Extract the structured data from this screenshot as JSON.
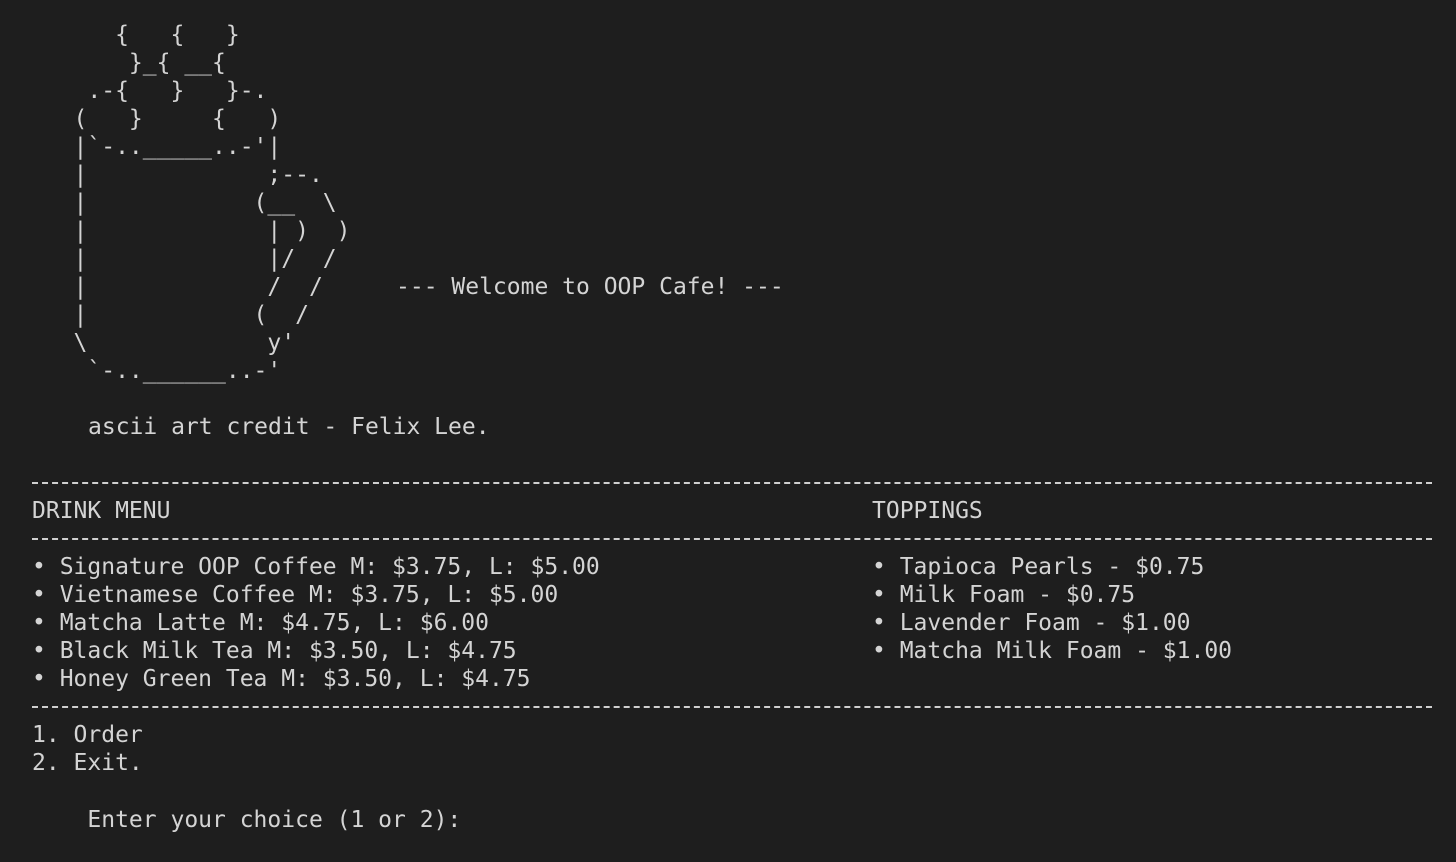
{
  "art": {
    "mug": "      {   {   }\n       }_{ __{\n    .-{   }   }-.\n   (   }     {   )\n   |`-.._____..-'|\n   |             ;--.\n   |            (__  \\\n   |             | )  )\n   |             |/  /\n   |             /  /\n   |            (  /\n   \\             y'\n    `-..______..-'",
    "welcome": "--- Welcome to OOP Cafe! ---",
    "credit": "ascii art credit - Felix Lee."
  },
  "menu": {
    "drinks_header": "DRINK MENU",
    "toppings_header": "TOPPINGS",
    "drinks": [
      "• Signature OOP Coffee M: $3.75, L: $5.00",
      "• Vietnamese Coffee M: $3.75, L: $5.00",
      "• Matcha Latte M: $4.75, L: $6.00",
      "• Black Milk Tea M: $3.50, L: $4.75",
      "• Honey Green Tea M: $3.50, L: $4.75"
    ],
    "toppings": [
      "• Tapioca Pearls - $0.75",
      "• Milk Foam - $0.75",
      "• Lavender Foam - $1.00",
      "• Matcha Milk Foam - $1.00"
    ]
  },
  "options": {
    "order": "1. Order",
    "exit": "2. Exit.",
    "prompt": "Enter your choice (1 or 2):"
  }
}
